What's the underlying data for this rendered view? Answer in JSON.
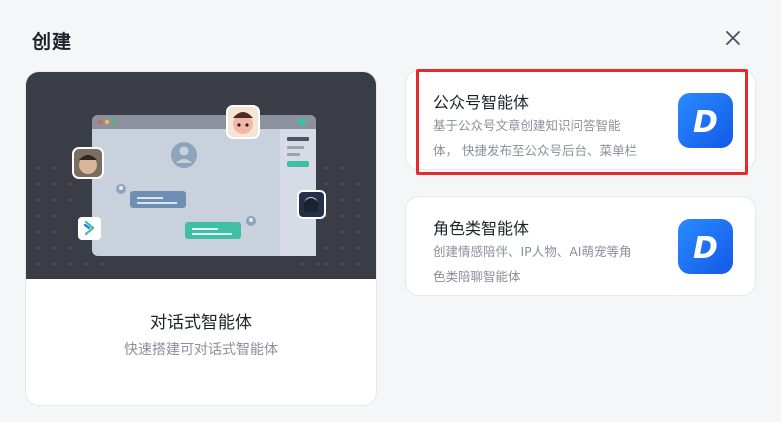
{
  "dialog": {
    "title": "创建",
    "close_icon": "close-icon"
  },
  "main_card": {
    "title": "对话式智能体",
    "description": "快速搭建可对话式智能体"
  },
  "cards": [
    {
      "title": "公众号智能体",
      "description": "基于公众号文章创建知识问答智能\n体，  快捷发布至公众号后台、菜单栏",
      "logo_letter": "D",
      "selected": true
    },
    {
      "title": "角色类智能体",
      "description": "创建情感陪伴、IP人物、AI萌宠等角\n色类陪聊智能体",
      "logo_letter": "D",
      "selected": false
    }
  ],
  "colors": {
    "accent": "#1f6fff",
    "highlight": "#e42a2a",
    "illustration_bg": "#3a3d46",
    "teal": "#3fc0a4"
  }
}
